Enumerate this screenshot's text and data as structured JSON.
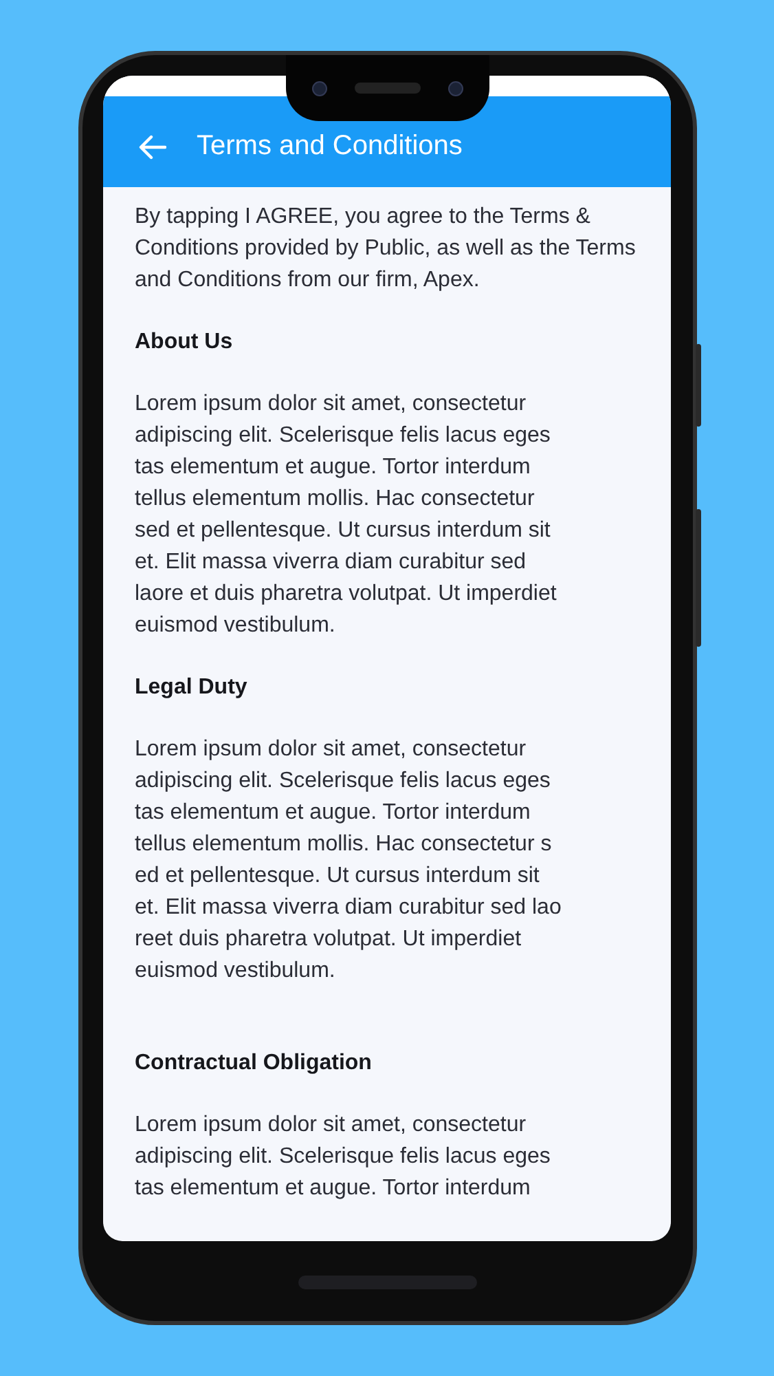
{
  "app_bar": {
    "title": "Terms and Conditions"
  },
  "intro": "By tapping I AGREE, you agree to the Terms & Conditions provided by Public, as well as the Terms and Conditions from our firm, Apex.",
  "sections": [
    {
      "heading": "About Us",
      "body": "Lorem ipsum dolor sit amet, consectetur\nadipiscing elit. Scelerisque felis lacus eges\ntas elementum et augue. Tortor interdum\ntellus elementum mollis. Hac consectetur\nsed et pellentesque. Ut cursus interdum sit\net. Elit massa viverra diam curabitur sed\nlaore et duis pharetra volutpat. Ut imperdiet\neuismod vestibulum."
    },
    {
      "heading": "Legal Duty",
      "body": "Lorem ipsum dolor sit amet, consectetur\nadipiscing elit. Scelerisque felis lacus eges\ntas elementum et augue. Tortor interdum\ntellus elementum mollis. Hac consectetur s\ned et pellentesque. Ut cursus interdum sit\net. Elit massa viverra diam curabitur sed lao\nreet duis pharetra volutpat. Ut imperdiet\neuismod vestibulum."
    },
    {
      "heading": "Contractual Obligation",
      "body": "Lorem ipsum dolor sit amet, consectetur\nadipiscing elit. Scelerisque felis lacus eges\ntas elementum et augue. Tortor interdum"
    }
  ]
}
